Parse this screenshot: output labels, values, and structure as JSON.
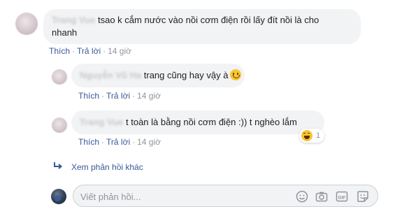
{
  "comments": [
    {
      "author": "Trang Vue",
      "text_line1": "tsao k cắm nước vào nồi cơm điện rồi lấy đít nồi là cho",
      "text_line2": "nhanh",
      "like": "Thích",
      "reply": "Trả lời",
      "time": "14 giờ"
    }
  ],
  "replies": [
    {
      "author": "Nguyễn Vũ Ha",
      "text": "trang cũng hay vậy à",
      "like": "Thích",
      "reply": "Trả lời",
      "time": "14 giờ"
    },
    {
      "author": "Trang Vue",
      "text": "t toàn là bằng nồi cơm điện :)) t nghèo lắm",
      "reaction_count": "1",
      "like": "Thích",
      "reply": "Trả lời",
      "time": "14 giờ"
    }
  ],
  "separator": "·",
  "more_replies": "Xem phản hồi khác",
  "reply_box": {
    "placeholder": "Viết phản hồi..."
  },
  "icons": [
    "emoji-icon",
    "camera-icon",
    "gif-icon",
    "sticker-icon",
    "reply-arrow-icon"
  ],
  "colors": {
    "link": "#385898",
    "bubble": "#f2f3f5",
    "meta": "#90949c"
  }
}
